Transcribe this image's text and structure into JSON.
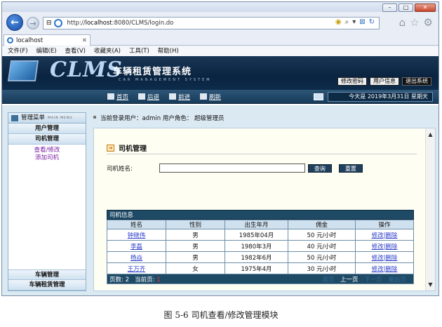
{
  "browser": {
    "url_prefix": "http://",
    "url_host": "localhost",
    "url_rest": ":8080/CLMS/login.do",
    "tab_title": "localhost",
    "menu": [
      "文件(F)",
      "编辑(E)",
      "查看(V)",
      "收藏夹(A)",
      "工具(T)",
      "帮助(H)"
    ]
  },
  "header": {
    "logo": "CLMS",
    "system_name": "车辆租赁管理系统",
    "system_name_en": "CAR  MANAGEMENT  SYSTEM",
    "buttons": [
      "修改密码",
      "用户信息",
      "退出系统"
    ]
  },
  "nav": {
    "links": [
      "首页",
      "后退",
      "前进",
      "刷新"
    ],
    "date": "今天是 2019年3月31日 星期天"
  },
  "sidebar": {
    "title": "管理菜单",
    "title_en": "MAIN MENU",
    "categories_top": [
      "用户管理",
      "司机管理"
    ],
    "links": [
      "查看/修改",
      "添加司机"
    ],
    "categories_bottom": [
      "车辆管理",
      "车辆租赁管理"
    ]
  },
  "userbar": {
    "text": "当前登录用户：admin  用户角色：  超级管理员"
  },
  "content": {
    "title": "司机管理",
    "search_label": "司机姓名:",
    "search_value": "",
    "query_btn": "查询",
    "reset_btn": "重置",
    "table": {
      "caption": "司机信息",
      "headers": [
        "姓名",
        "性别",
        "出生年月",
        "佣金",
        "操作"
      ],
      "rows": [
        {
          "name": "钟晓伟",
          "gender": "男",
          "birth": "1985年04月",
          "fee": "50  元/小时",
          "op": "修改|删除"
        },
        {
          "name": "李磊",
          "gender": "男",
          "birth": "1980年3月",
          "fee": "40  元/小时",
          "op": "修改|删除"
        },
        {
          "name": "杨焱",
          "gender": "男",
          "birth": "1982年6月",
          "fee": "50  元/小时",
          "op": "修改|删除"
        },
        {
          "name": "王万齐",
          "gender": "女",
          "birth": "1975年4月",
          "fee": "30  元/小时",
          "op": "修改|删除"
        }
      ],
      "footer": {
        "pages_label": "页数: ",
        "pages": "2",
        "current_label": "当前页: ",
        "current": "1",
        "pager": [
          "首页",
          "上一页",
          "下一页",
          "最后页"
        ]
      }
    }
  },
  "figure_caption": "图 5-6  司机查看/修改管理模块"
}
